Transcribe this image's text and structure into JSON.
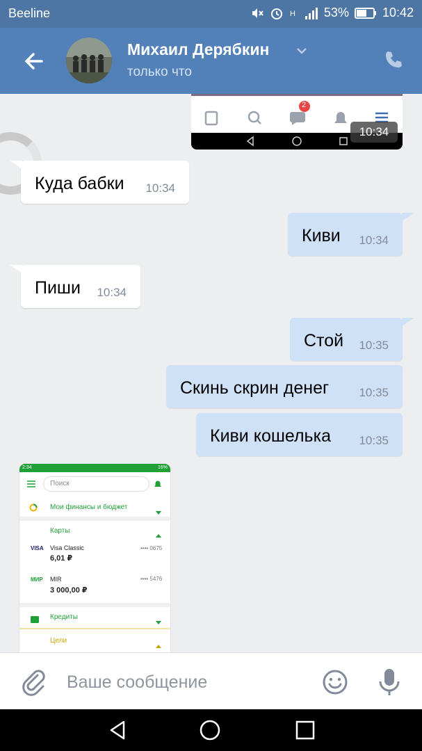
{
  "status_bar": {
    "carrier": "Beeline",
    "battery": "53%",
    "time": "10:42",
    "icons": [
      "mute-icon",
      "alarm-icon",
      "h-plus-icon",
      "signal-icon",
      "battery-icon"
    ]
  },
  "header": {
    "contact_name": "Михаил Дерябкин",
    "presence": "только что",
    "icons": [
      "back-arrow-icon",
      "chevron-down-icon",
      "phone-icon"
    ]
  },
  "attachment_top": {
    "badge_count": "2",
    "time": "10:34"
  },
  "messages": [
    {
      "dir": "in",
      "text": "Куда бабки",
      "time": "10:34"
    },
    {
      "dir": "out",
      "text": "Киви",
      "time": "10:34"
    },
    {
      "dir": "in",
      "text": "Пиши",
      "time": "10:34"
    },
    {
      "dir": "out",
      "text": "Стой",
      "time": "10:35"
    },
    {
      "dir": "out",
      "text": "Скинь скрин денег",
      "time": "10:35"
    },
    {
      "dir": "out",
      "text": "Киви кошелька",
      "time": "10:35"
    }
  ],
  "attachment_bank": {
    "status_time": "2:34",
    "search_placeholder": "Поиск",
    "finance_label": "Мои финансы и бюджет",
    "cards_label": "Карты",
    "card1_brand": "VISA",
    "card1_name": "Visa Classic",
    "card1_amount": "6,01 ₽",
    "card1_number": "•••• 0675",
    "card2_brand": "МИР",
    "card2_name": "MIR",
    "card2_amount": "3 000,00 ₽",
    "card2_number": "•••• 5476",
    "credits_label": "Кредиты",
    "goals_label": "Цели",
    "status_battery": "16%"
  },
  "composer": {
    "placeholder": "Ваше сообщение",
    "icons": [
      "paperclip-icon",
      "emoji-icon",
      "microphone-icon"
    ]
  },
  "colors": {
    "header": "#5181b8",
    "status_bar": "#4e76a5",
    "chat_bg": "#edeef0",
    "bubble_out": "#cfe1f7",
    "bubble_in": "#ffffff"
  }
}
